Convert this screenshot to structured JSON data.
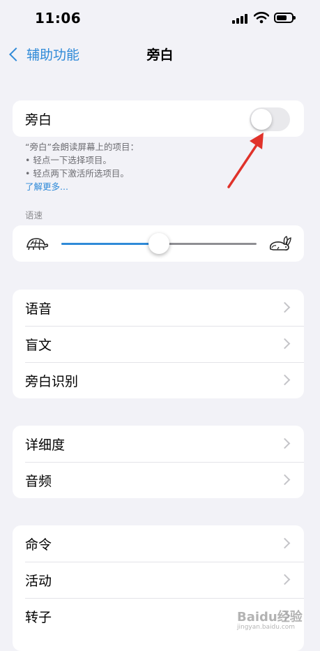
{
  "status_bar": {
    "time": "11:06"
  },
  "nav": {
    "back_label": "辅助功能",
    "title": "旁白"
  },
  "voiceover": {
    "label": "旁白",
    "enabled": false,
    "description": "“旁白”会朗读屏幕上的项目：",
    "hints": [
      "• 轻点一下选择项目。",
      "• 轻点两下激活所选项目。"
    ],
    "learn_more": "了解更多..."
  },
  "speaking_rate": {
    "label": "语速",
    "value": 0.5
  },
  "group1": {
    "items": [
      "语音",
      "盲文",
      "旁白识别"
    ]
  },
  "group2": {
    "items": [
      "详细度",
      "音频"
    ]
  },
  "group3": {
    "items": [
      "命令",
      "活动",
      "转子"
    ]
  },
  "watermark": {
    "text": "Baidu经验",
    "sub": "jingyan.baidu.com"
  },
  "colors": {
    "accent": "#2f8ad8",
    "annotation_arrow": "#e0322a",
    "background": "#f2f2f7"
  }
}
